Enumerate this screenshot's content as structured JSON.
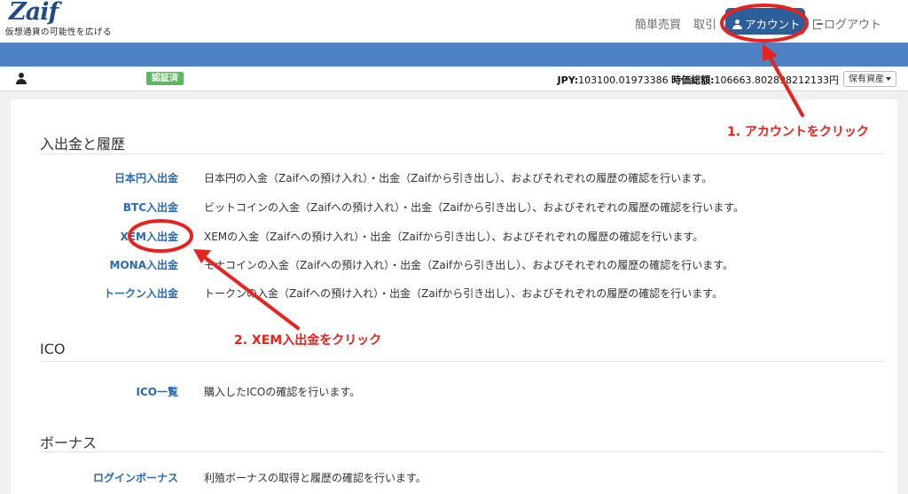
{
  "header": {
    "logo_text": "Zaif",
    "tagline": "仮想通貨の可能性を広げる",
    "nav": {
      "kantan": "簡単売買",
      "torihiki": "取引",
      "account": "アカウント",
      "logout": "ログアウト"
    }
  },
  "infobar": {
    "verified_badge": "認証済",
    "jpy_label": "JPY:",
    "jpy_value": "103100.01973386",
    "total_label": "時価総額:",
    "total_value": "106663.802898212133円",
    "asset_button": "保有資産"
  },
  "sections": [
    {
      "title": "入出金と履歴",
      "rows": [
        {
          "link": "日本円入出金",
          "desc": "日本円の入金（Zaifへの預け入れ）・出金（Zaifから引き出し）、およびそれぞれの履歴の確認を行います。"
        },
        {
          "link": "BTC入出金",
          "desc": "ビットコインの入金（Zaifへの預け入れ）・出金（Zaifから引き出し）、およびそれぞれの履歴の確認を行います。"
        },
        {
          "link": "XEM入出金",
          "desc": "XEMの入金（Zaifへの預け入れ）・出金（Zaifから引き出し）、およびそれぞれの履歴の確認を行います。"
        },
        {
          "link": "MONA入出金",
          "desc": "モナコインの入金（Zaifへの預け入れ）・出金（Zaifから引き出し）、およびそれぞれの履歴の確認を行います。"
        },
        {
          "link": "トークン入出金",
          "desc": "トークンの入金（Zaifへの預け入れ）・出金（Zaifから引き出し）、およびそれぞれの履歴の確認を行います。"
        }
      ]
    },
    {
      "title": "ICO",
      "rows": [
        {
          "link": "ICO一覧",
          "desc": "購入したICOの確認を行います。"
        }
      ]
    },
    {
      "title": "ボーナス",
      "rows": [
        {
          "link": "ログインボーナス",
          "desc": "利殖ボーナスの取得と履歴の確認を行います。"
        }
      ]
    }
  ],
  "annotations": {
    "step1": "1. アカウントをクリック",
    "step2": "2. XEM入出金をクリック",
    "color": "#e8221c"
  }
}
